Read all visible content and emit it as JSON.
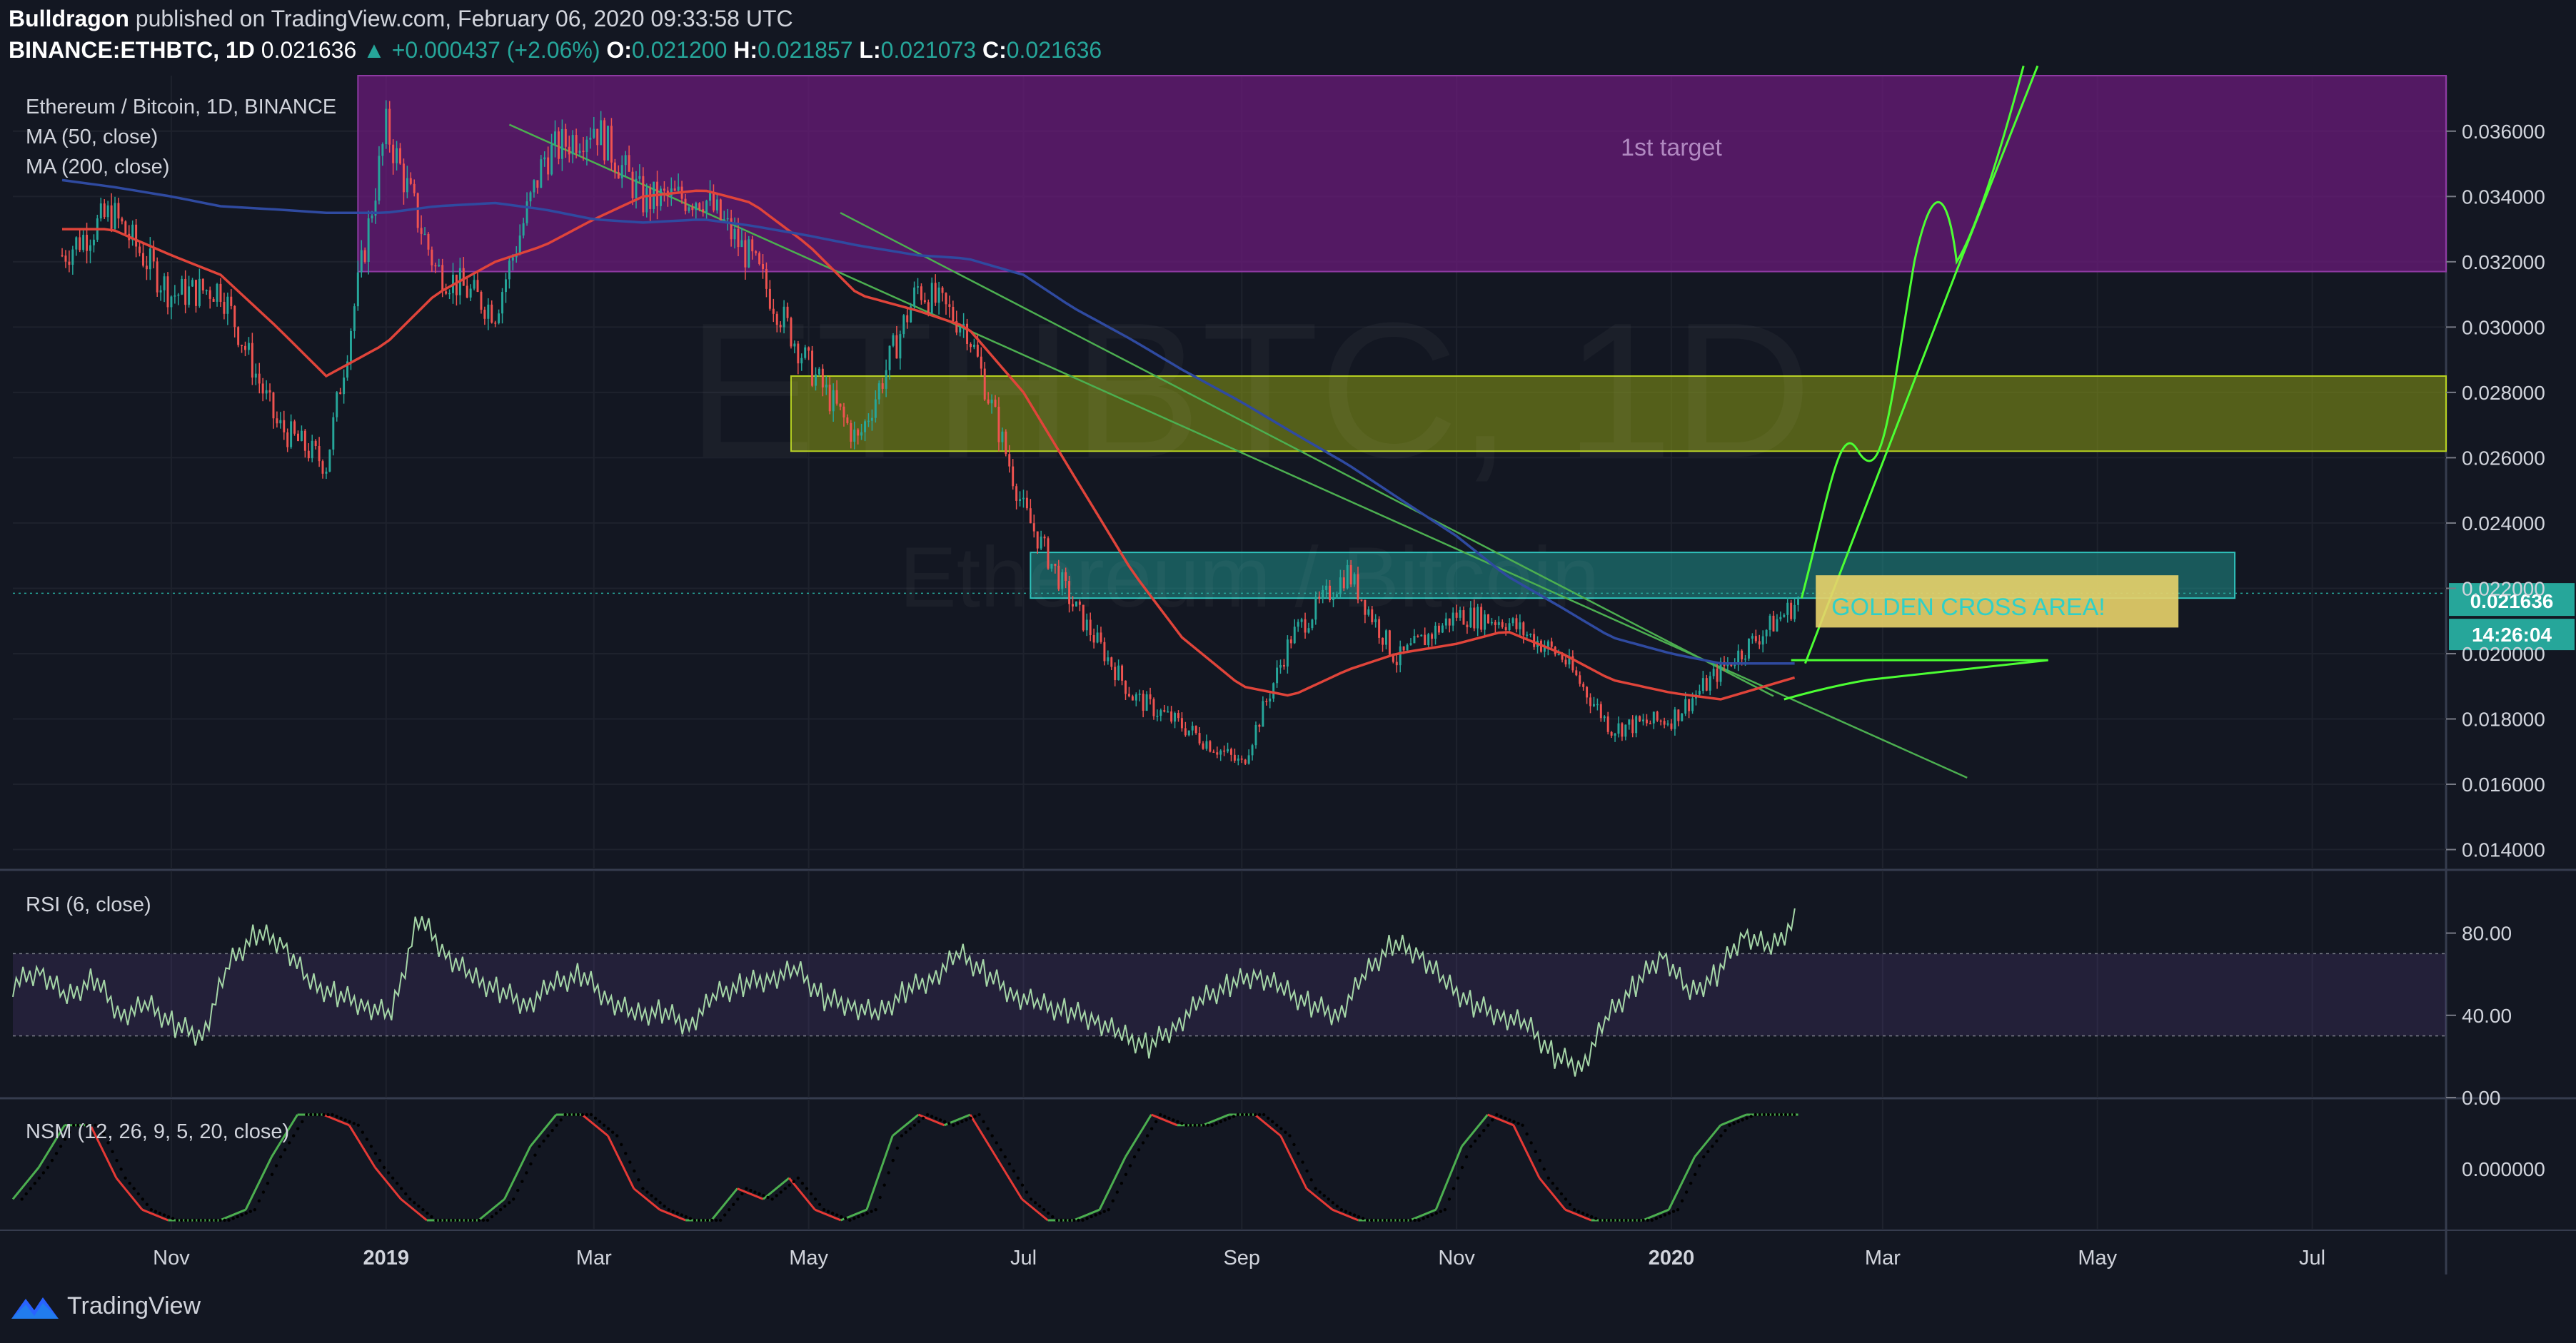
{
  "header": {
    "author": "Bulldragon",
    "published_text": "published on TradingView.com, February 06, 2020 09:33:58 UTC",
    "symbol": "BINANCE:ETHBTC, 1D",
    "last": "0.021636",
    "change": "▲ +0.000437 (+2.06%)",
    "o_label": "O:",
    "o": "0.021200",
    "h_label": "H:",
    "h": "0.021857",
    "l_label": "L:",
    "l": "0.021073",
    "c_label": "C:",
    "c": "0.021636"
  },
  "legend": {
    "title": "Ethereum / Bitcoin, 1D, BINANCE",
    "ma50": "MA (50, close)",
    "ma200": "MA (200, close)",
    "rsi": "RSI (6, close)",
    "nsm": "NSM (12, 26, 9, 5, 20, close)"
  },
  "watermark": {
    "line1": "ETHBTC, 1D",
    "line2": "Ethereum / Bitcoin"
  },
  "annotations": {
    "target": "1st target",
    "golden": "GOLDEN CROSS AREA!"
  },
  "price_badge": {
    "value": "0.021636",
    "countdown": "14:26:04"
  },
  "brand": {
    "name": "TradingView"
  },
  "colors": {
    "background": "#131722",
    "up": "#26a69a",
    "down": "#ef5350",
    "ma50": "#e0443a",
    "ma200": "#2f4aa0",
    "purple_zone": "#6a1b7a",
    "yellow_zone": "#8a9a14",
    "teal_zone": "#1f8f8a",
    "projection": "#4cff33"
  },
  "chart_data": [
    {
      "type": "line",
      "title": "Ethereum / Bitcoin, 1D, BINANCE",
      "xlabel": "",
      "ylabel": "",
      "x": [
        "2018-10-01",
        "2018-10-15",
        "2018-11-01",
        "2018-11-15",
        "2018-12-01",
        "2018-12-15",
        "2019-01-01",
        "2019-01-15",
        "2019-02-01",
        "2019-02-15",
        "2019-03-01",
        "2019-03-15",
        "2019-04-01",
        "2019-04-15",
        "2019-05-01",
        "2019-05-15",
        "2019-06-01",
        "2019-06-15",
        "2019-07-01",
        "2019-07-15",
        "2019-08-01",
        "2019-08-15",
        "2019-09-01",
        "2019-09-15",
        "2019-10-01",
        "2019-10-15",
        "2019-11-01",
        "2019-11-15",
        "2019-12-01",
        "2019-12-15",
        "2020-01-01",
        "2020-01-15",
        "2020-02-06"
      ],
      "series": [
        {
          "name": "ETHBTC",
          "values": [
            0.0322,
            0.0335,
            0.031,
            0.0312,
            0.027,
            0.0258,
            0.0361,
            0.0318,
            0.0305,
            0.0352,
            0.0362,
            0.0339,
            0.034,
            0.032,
            0.0288,
            0.0265,
            0.0312,
            0.03,
            0.0244,
            0.0215,
            0.0187,
            0.0178,
            0.0166,
            0.0205,
            0.0225,
            0.0198,
            0.0212,
            0.021,
            0.0199,
            0.0177,
            0.018,
            0.0195,
            0.0216
          ]
        },
        {
          "name": "MA (50, close)",
          "values": [
            0.033,
            0.033,
            0.0322,
            0.0316,
            0.03,
            0.0285,
            0.0295,
            0.031,
            0.032,
            0.0325,
            0.0333,
            0.034,
            0.0342,
            0.0338,
            0.0325,
            0.031,
            0.0305,
            0.03,
            0.028,
            0.0255,
            0.0225,
            0.0205,
            0.019,
            0.0187,
            0.0195,
            0.02,
            0.0203,
            0.0207,
            0.02,
            0.0192,
            0.0188,
            0.0186,
            0.0193
          ]
        },
        {
          "name": "MA (200, close)",
          "values": [
            0.0345,
            0.0343,
            0.034,
            0.0337,
            0.0336,
            0.0335,
            0.0335,
            0.0337,
            0.0338,
            0.0336,
            0.0333,
            0.0332,
            0.0333,
            0.0331,
            0.0328,
            0.0325,
            0.0322,
            0.0321,
            0.0316,
            0.0306,
            0.0296,
            0.0287,
            0.0277,
            0.0268,
            0.0258,
            0.0248,
            0.0236,
            0.0224,
            0.0214,
            0.0205,
            0.02,
            0.0197,
            0.0197
          ]
        }
      ],
      "yticks": [
        "0.014000",
        "0.016000",
        "0.018000",
        "0.020000",
        "0.022000",
        "0.024000",
        "0.026000",
        "0.028000",
        "0.030000",
        "0.032000",
        "0.034000",
        "0.036000"
      ],
      "ylim": [
        0.0134,
        0.0377
      ],
      "zones": [
        {
          "label": "1st target",
          "from": 0.0317,
          "to": 0.0377
        },
        {
          "label": "",
          "from": 0.0262,
          "to": 0.0285
        },
        {
          "label": "",
          "from": 0.0217,
          "to": 0.0231
        }
      ]
    },
    {
      "type": "line",
      "title": "RSI (6, close)",
      "yticks": [
        "0.00",
        "40.00",
        "80.00"
      ],
      "ylim": [
        0,
        100
      ],
      "band": [
        30,
        70
      ],
      "series": [
        {
          "name": "RSI (6, close)",
          "values": [
            55,
            62,
            48,
            58,
            40,
            45,
            35,
            30,
            65,
            80,
            75,
            55,
            50,
            45,
            40,
            88,
            70,
            58,
            52,
            45,
            55,
            60,
            48,
            40,
            42,
            35,
            50,
            55,
            58,
            62,
            48,
            45,
            40,
            52,
            58,
            70,
            60,
            50,
            45,
            42,
            38,
            30,
            25,
            35,
            48,
            55,
            60,
            52,
            45,
            40,
            60,
            75,
            70,
            55,
            45,
            40,
            35,
            20,
            15,
            40,
            55,
            70,
            50,
            60,
            80,
            72,
            88
          ]
        }
      ]
    },
    {
      "type": "line",
      "title": "NSM (12, 26, 9, 5, 20, close)",
      "yticks": [
        "0.000000"
      ],
      "series": [
        {
          "name": "NSM (12, 26, 9, 5, 20, close)",
          "values": [
            0.2,
            0.5,
            0.9,
            0.9,
            0.4,
            0.1,
            0.0,
            0.0,
            0.0,
            0.1,
            0.6,
            1.0,
            1.0,
            0.9,
            0.5,
            0.2,
            0.0,
            0.0,
            0.0,
            0.2,
            0.7,
            1.0,
            1.0,
            0.8,
            0.3,
            0.1,
            0.0,
            0.0,
            0.3,
            0.2,
            0.4,
            0.1,
            0.0,
            0.1,
            0.8,
            1.0,
            0.9,
            1.0,
            0.6,
            0.2,
            0.0,
            0.0,
            0.1,
            0.6,
            1.0,
            0.9,
            0.9,
            1.0,
            1.0,
            0.8,
            0.3,
            0.1,
            0.0,
            0.0,
            0.0,
            0.1,
            0.7,
            1.0,
            0.9,
            0.4,
            0.1,
            0.0,
            0.0,
            0.0,
            0.1,
            0.6,
            0.9,
            1.0,
            1.0,
            1.0
          ]
        }
      ]
    }
  ],
  "x_axis": {
    "ticks": [
      {
        "label": "Nov",
        "date": "2018-11-01",
        "bold": false
      },
      {
        "label": "2019",
        "date": "2019-01-01",
        "bold": true
      },
      {
        "label": "Mar",
        "date": "2019-03-01",
        "bold": false
      },
      {
        "label": "May",
        "date": "2019-05-01",
        "bold": false
      },
      {
        "label": "Jul",
        "date": "2019-07-01",
        "bold": false
      },
      {
        "label": "Sep",
        "date": "2019-09-01",
        "bold": false
      },
      {
        "label": "Nov",
        "date": "2019-11-01",
        "bold": false
      },
      {
        "label": "2020",
        "date": "2020-01-01",
        "bold": true
      },
      {
        "label": "Mar",
        "date": "2020-03-01",
        "bold": false
      },
      {
        "label": "May",
        "date": "2020-05-01",
        "bold": false
      },
      {
        "label": "Jul",
        "date": "2020-07-01",
        "bold": false
      }
    ],
    "range": [
      "2018-09-17",
      "2020-08-08"
    ]
  }
}
